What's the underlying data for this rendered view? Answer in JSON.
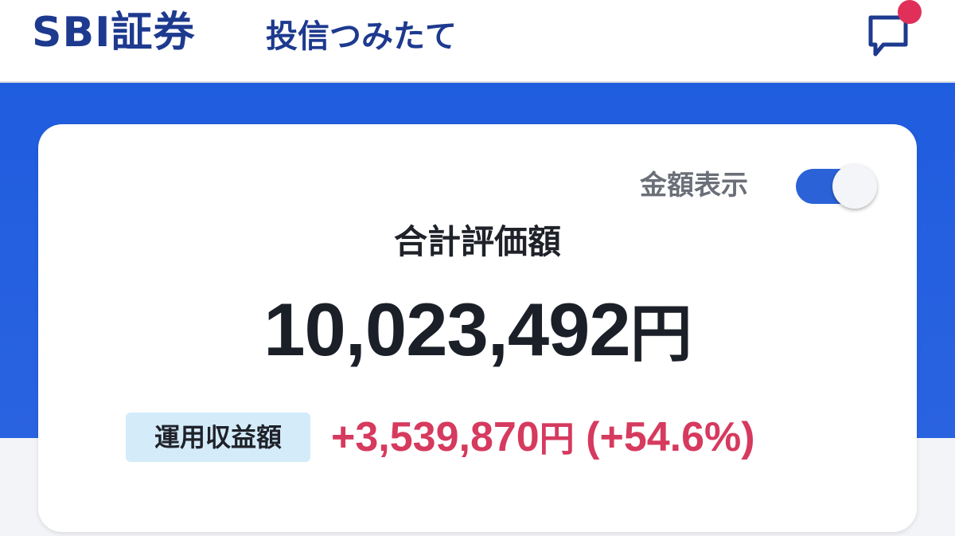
{
  "header": {
    "brand": "SBI証券",
    "app_title": "投信つみたて",
    "message_icon": "chat-bubble-icon",
    "notification_dot_color": "#e0305a"
  },
  "summary_card": {
    "toggle": {
      "label": "金額表示",
      "state": "on",
      "color": "#2c62d8"
    },
    "total_label": "合計評価額",
    "total_amount": "10,023,492",
    "total_unit": "円",
    "profit_label": "運用収益額",
    "profit_amount": "+3,539,870",
    "profit_unit": "円",
    "profit_percent": "(+54.6%)",
    "profit_color": "#d63a5e"
  },
  "colors": {
    "brand": "#1d3a8f",
    "hero_band": "#1f5ddf",
    "badge_bg": "#d4ebfa"
  }
}
